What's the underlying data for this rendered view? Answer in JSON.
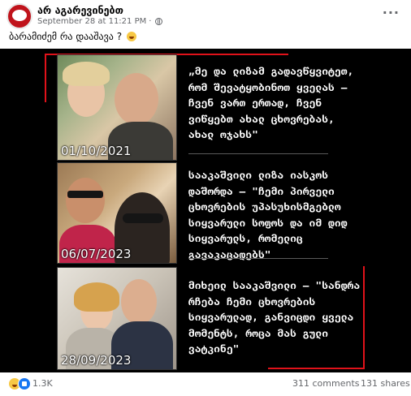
{
  "post": {
    "page_name": "არ აგარევინებთ",
    "timestamp": "September 28 at 11:21 PM",
    "caption": "ბარამიძემ რა დააშავა ?"
  },
  "image": {
    "panels": [
      {
        "date": "01/10/2021",
        "quote": "„მე და ლიზამ გადავწყვიტეთ, რომ შევატყობინოთ ყველას – ჩვენ ვართ ერთად, ჩვენ ვიწყებთ ახალ ცხოვრებას, ახალ ოჯახს\""
      },
      {
        "date": "06/07/2023",
        "quote": "სააკაშვილი ლიზა იასკოს დაშორდა – \"ჩემი პირველი ცხოვრების უპასუხისმგებლო სიყვარული სოფოს და იმ დიდ სიყვარულს, რომელიც გავაკაცადებს\""
      },
      {
        "date": "28/09/2023",
        "quote": "მიხეილ სააკაშვილი – \"სანდრა რჩება ჩემი ცხოვრების სიყვარულად, განვიცდი ყველა მომენტს, როცა მას გული ვატკინე\""
      }
    ]
  },
  "footer": {
    "reaction_count": "1.3K",
    "comments": "311 comments",
    "shares": "131 shares"
  },
  "colors": {
    "accent_red": "#e0121a",
    "link_blue": "#1877f2"
  }
}
